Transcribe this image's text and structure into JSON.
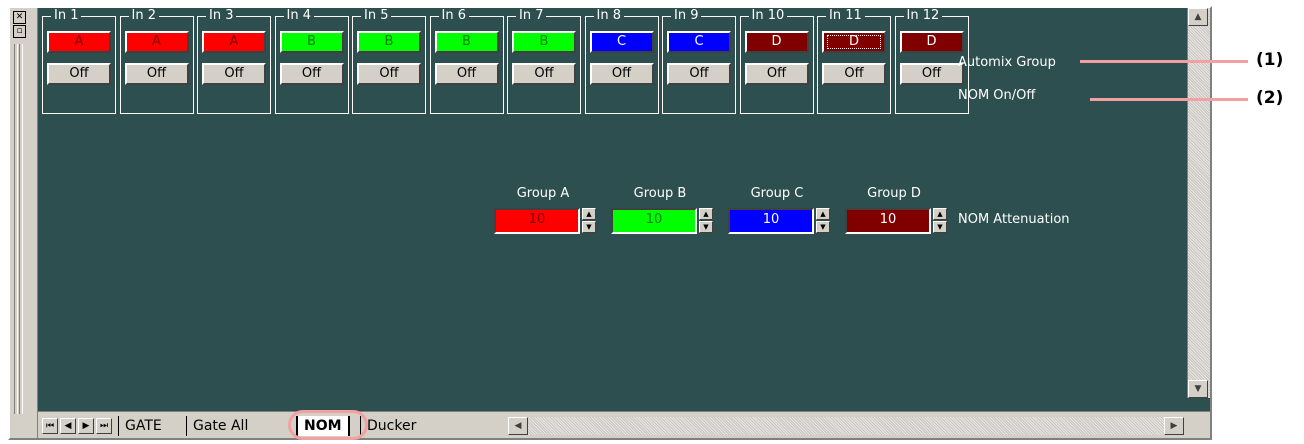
{
  "channels": [
    {
      "label": "In 1",
      "group": "A",
      "nom": "Off",
      "color": "#ff0000",
      "text_color": "#800000"
    },
    {
      "label": "In 2",
      "group": "A",
      "nom": "Off",
      "color": "#ff0000",
      "text_color": "#800000"
    },
    {
      "label": "In 3",
      "group": "A",
      "nom": "Off",
      "color": "#ff0000",
      "text_color": "#800000"
    },
    {
      "label": "In 4",
      "group": "B",
      "nom": "Off",
      "color": "#00ff00",
      "text_color": "#008000"
    },
    {
      "label": "In 5",
      "group": "B",
      "nom": "Off",
      "color": "#00ff00",
      "text_color": "#008000"
    },
    {
      "label": "In 6",
      "group": "B",
      "nom": "Off",
      "color": "#00ff00",
      "text_color": "#008000"
    },
    {
      "label": "In 7",
      "group": "B",
      "nom": "Off",
      "color": "#00ff00",
      "text_color": "#008000"
    },
    {
      "label": "In 8",
      "group": "C",
      "nom": "Off",
      "color": "#0000ff",
      "text_color": "#ffffff"
    },
    {
      "label": "In 9",
      "group": "C",
      "nom": "Off",
      "color": "#0000ff",
      "text_color": "#ffffff"
    },
    {
      "label": "In 10",
      "group": "D",
      "nom": "Off",
      "color": "#800000",
      "text_color": "#ffffff"
    },
    {
      "label": "In 11",
      "group": "D",
      "nom": "Off",
      "color": "#800000",
      "text_color": "#ffffff"
    },
    {
      "label": "In 12",
      "group": "D",
      "nom": "Off",
      "color": "#800000",
      "text_color": "#ffffff"
    }
  ],
  "row_labels": {
    "automix": "Automix Group",
    "nom_onoff": "NOM On/Off"
  },
  "attenuation": {
    "label": "NOM Attenuation",
    "groups": [
      {
        "name": "Group A",
        "value": "10",
        "color": "#ff0000",
        "text_color": "#800000"
      },
      {
        "name": "Group B",
        "value": "10",
        "color": "#00ff00",
        "text_color": "#008000"
      },
      {
        "name": "Group C",
        "value": "10",
        "color": "#0000ff",
        "text_color": "#ffffff"
      },
      {
        "name": "Group D",
        "value": "10",
        "color": "#800000",
        "text_color": "#ffffff"
      }
    ]
  },
  "tabs": [
    {
      "label": "GATE",
      "active": false
    },
    {
      "label": "Gate All",
      "active": false
    },
    {
      "label": "NOM",
      "active": true
    },
    {
      "label": "Ducker",
      "active": false
    }
  ],
  "callouts": {
    "one": "(1)",
    "two": "(2)"
  }
}
